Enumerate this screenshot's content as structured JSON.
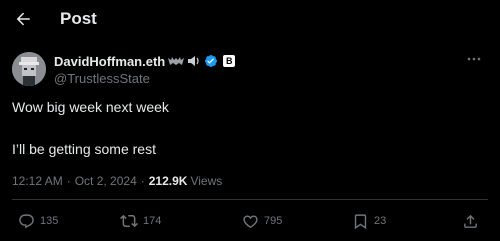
{
  "header": {
    "title": "Post",
    "back_icon": "arrow-left-icon"
  },
  "author": {
    "display_name": "DavidHoffman.eth",
    "handle": "@TrustlessState",
    "verified_color": "#1d9bf0",
    "badge_letter": "B",
    "badges": [
      "bat-icon",
      "speaker-icon",
      "verified-icon",
      "b-badge"
    ]
  },
  "tweet": {
    "line1": "Wow big week next week",
    "line2": "I’ll be getting some rest"
  },
  "meta": {
    "time": "12:12 AM",
    "separator": "·",
    "date": "Oct 2, 2024",
    "views_count": "212.9K",
    "views_label": "Views"
  },
  "actions": {
    "replies": "135",
    "reposts": "174",
    "likes": "795",
    "bookmarks": "23"
  },
  "colors": {
    "background": "#000000",
    "text": "#e7e9ea",
    "muted": "#71767b",
    "divider": "#2f3336"
  }
}
